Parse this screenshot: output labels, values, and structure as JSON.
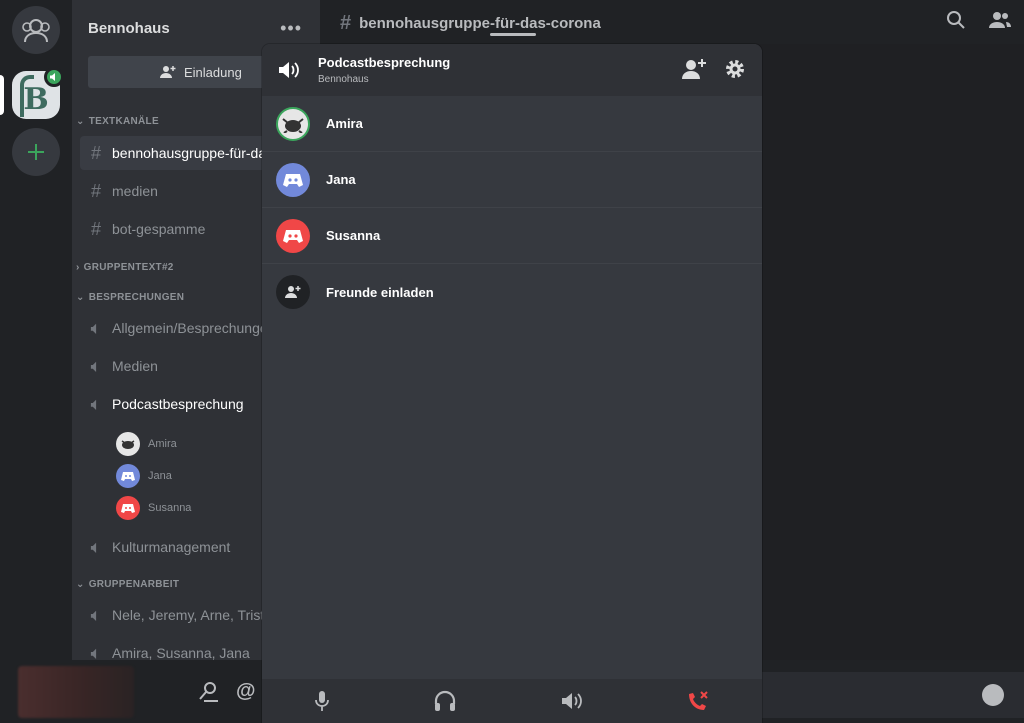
{
  "server": {
    "name": "Bennohaus",
    "letter": "B",
    "invite_label": "Einladung"
  },
  "categories": {
    "textkanaele": "TEXTKANÄLE",
    "gruppentext": "GRUPPENTEXT#2",
    "besprechungen": "BESPRECHUNGEN",
    "gruppenarbeit": "GRUPPENARBEIT"
  },
  "channels": {
    "text": [
      "bennohausgruppe-für-das-corona",
      "medien",
      "bot-gespamme"
    ],
    "voice_besprechungen": [
      "Allgemein/Besprechungen",
      "Medien",
      "Podcastbesprechung",
      "Kulturmanagement"
    ],
    "voice_gruppenarbeit": [
      "Nele, Jeremy, Arne, Tristan",
      "Amira, Susanna, Jana"
    ]
  },
  "voice_users": [
    "Amira",
    "Jana",
    "Susanna"
  ],
  "main": {
    "channel_title": "bennohausgruppe-für-das-corona"
  },
  "popup": {
    "title": "Podcastbesprechung",
    "subtitle": "Bennohaus",
    "members": [
      "Amira",
      "Jana",
      "Susanna"
    ],
    "invite_label": "Freunde einladen"
  },
  "colors": {
    "accent_green": "#3ba55c",
    "blurple": "#7289da",
    "red": "#f04747"
  },
  "icons": {
    "home": "friends-icon",
    "add": "plus-icon",
    "search": "search-icon",
    "members": "members-icon",
    "mic": "microphone-icon",
    "headphones": "headphones-icon",
    "speaker": "speaker-icon",
    "disconnect": "disconnect-call-icon"
  }
}
